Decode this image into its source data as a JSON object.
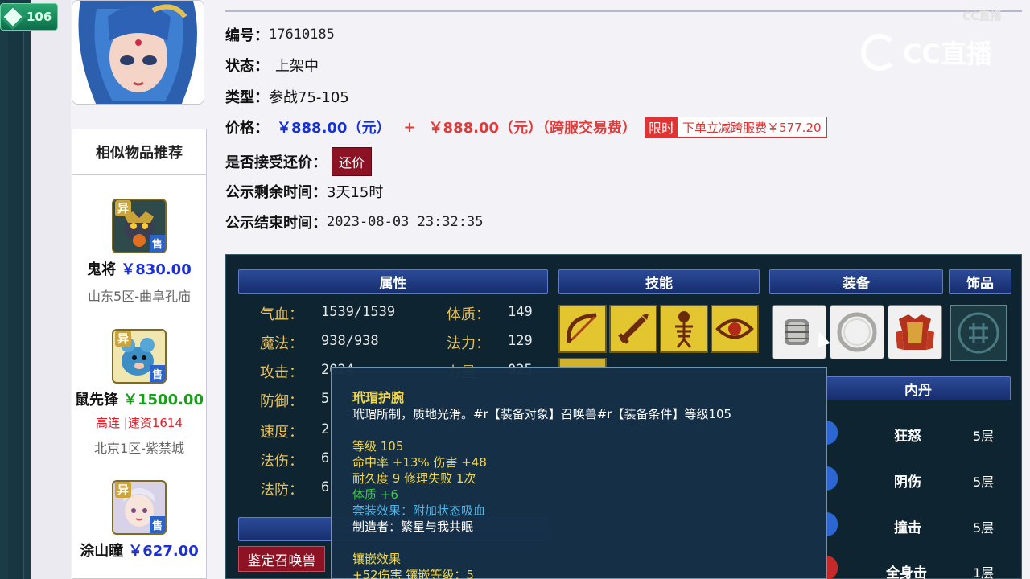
{
  "badge": {
    "level": "106"
  },
  "similar": {
    "title": "相似物品推荐",
    "items": [
      {
        "name": "鬼将",
        "price": "￥830.00",
        "tags": "",
        "tag2": "",
        "server": "山东5区-曲阜孔庙",
        "yi": "异",
        "shou": "售"
      },
      {
        "name": "鼠先锋",
        "price": "￥1500.00",
        "tags": "高连",
        "tag2": "速资1614",
        "server": "北京1区-紫禁城",
        "yi": "异",
        "shou": "售"
      },
      {
        "name": "涂山瞳",
        "price": "￥627.00",
        "tags": "",
        "tag2": "",
        "server": "",
        "yi": "异",
        "shou": "售"
      }
    ]
  },
  "info": {
    "id_label": "编号：",
    "id_value": "17610185",
    "status_label": "状态：",
    "status_value": "上架中",
    "type_label": "类型：",
    "type_value": "参战75-105",
    "price_label": "价格：",
    "price_main": "￥888.00（元）",
    "price_plus": "+",
    "price_fee": "￥888.00（元）（跨服交易费）",
    "promo_tag": "限时",
    "promo_text": "下单立减跨服费￥577.20",
    "counter_label": "是否接受还价：",
    "counter_button": "还价",
    "remain_label": "公示剩余时间：",
    "remain_value": "3天15时",
    "end_label": "公示结束时间：",
    "end_value": "2023-08-03 23:32:35"
  },
  "watermark": {
    "small": "CC直播",
    "big": "CC直播"
  },
  "panel": {
    "headers": {
      "attr": "属性",
      "skill": "技能",
      "equip": "装备",
      "ornament": "饰品",
      "neidan": "内丹"
    },
    "attrs_left": [
      {
        "label": "气血：",
        "value": "1539/1539"
      },
      {
        "label": "魔法：",
        "value": "938/938"
      },
      {
        "label": "攻击：",
        "value": "2024"
      },
      {
        "label": "防御：",
        "value": "5"
      },
      {
        "label": "速度：",
        "value": "2"
      },
      {
        "label": "法伤：",
        "value": "6"
      },
      {
        "label": "法防：",
        "value": "6"
      }
    ],
    "attrs_right": [
      {
        "label": "体质：",
        "value": "149"
      },
      {
        "label": "法力：",
        "value": "129"
      },
      {
        "label": "力量",
        "value": "025"
      }
    ],
    "skills": [
      "skill-bow-icon",
      "skill-sword-icon",
      "skill-skeleton-icon",
      "skill-eye-icon"
    ],
    "neidan": [
      {
        "name": "狂怒",
        "level": "5层"
      },
      {
        "name": "阴伤",
        "level": "5层"
      },
      {
        "name": "撞击",
        "level": "5层"
      },
      {
        "name": "全身击",
        "level": "1层"
      }
    ],
    "appraise_button": "鉴定召唤兽"
  },
  "tooltip": {
    "title": "玳瑁护腕",
    "desc": "玳瑁所制，质地光滑。#r【装备对象】召唤兽#r【装备条件】等级105",
    "level": "等级 105",
    "line2": "命中率 +13% 伤害 +48",
    "line3": "耐久度 9 修理失败 1次",
    "line4": "体质 +6",
    "line5": "套装效果：附加状态吸血",
    "line6": "制造者：繁星与我共眠",
    "line7": "镶嵌效果",
    "line8": "+52伤害 镶嵌等级：5"
  }
}
